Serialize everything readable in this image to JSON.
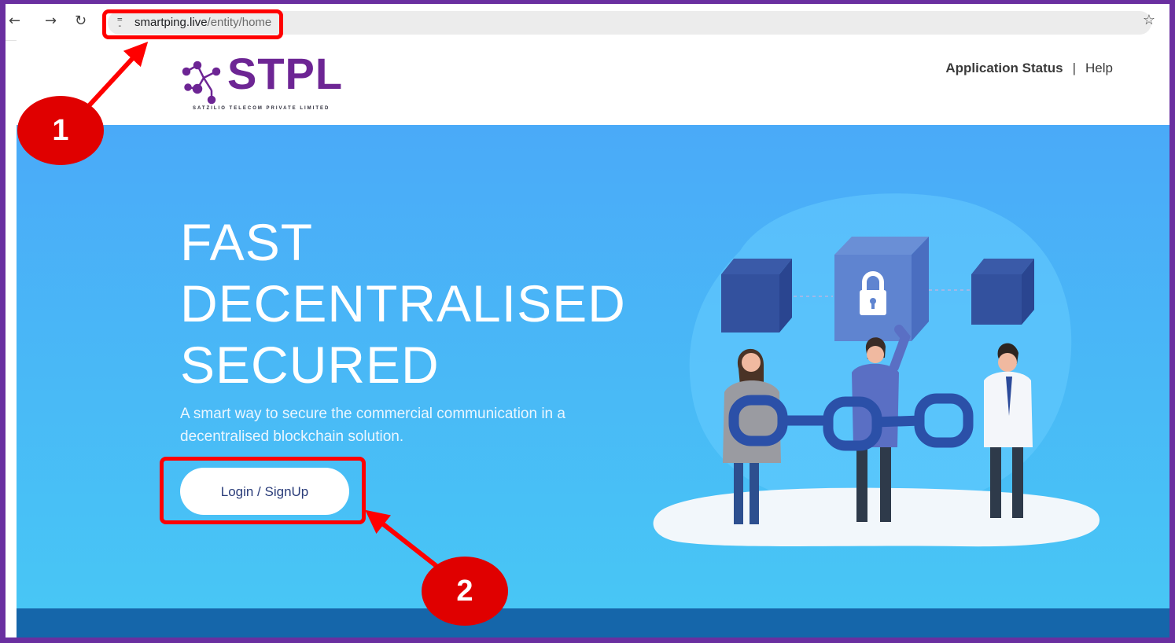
{
  "browser": {
    "back_icon": "back-arrow-icon",
    "forward_icon": "forward-arrow-icon",
    "reload_icon": "reload-icon",
    "url_domain": "smartping.live",
    "url_path": "/entity/home",
    "bookmark_icon": "star-icon"
  },
  "header": {
    "logo_text": "STPL",
    "logo_subtitle": "SATZILIO TELECOM PRIVATE LIMITED",
    "nav": {
      "application_status": "Application Status",
      "separator": "|",
      "help": "Help"
    }
  },
  "hero": {
    "title_lines": [
      "FAST",
      "DECENTRALISED",
      "SECURED"
    ],
    "subtitle": "A smart way to secure the commercial communication in a decentralised blockchain solution.",
    "login_button": "Login / SignUp"
  },
  "annotations": {
    "callout_1": "1",
    "callout_2": "2"
  },
  "colors": {
    "frame": "#6a2fa0",
    "brand_purple": "#6d2594",
    "hero_top": "#4aaaf8",
    "hero_bottom": "#48c6f5",
    "footer_band": "#1566aa",
    "callout_red": "#e00000"
  }
}
